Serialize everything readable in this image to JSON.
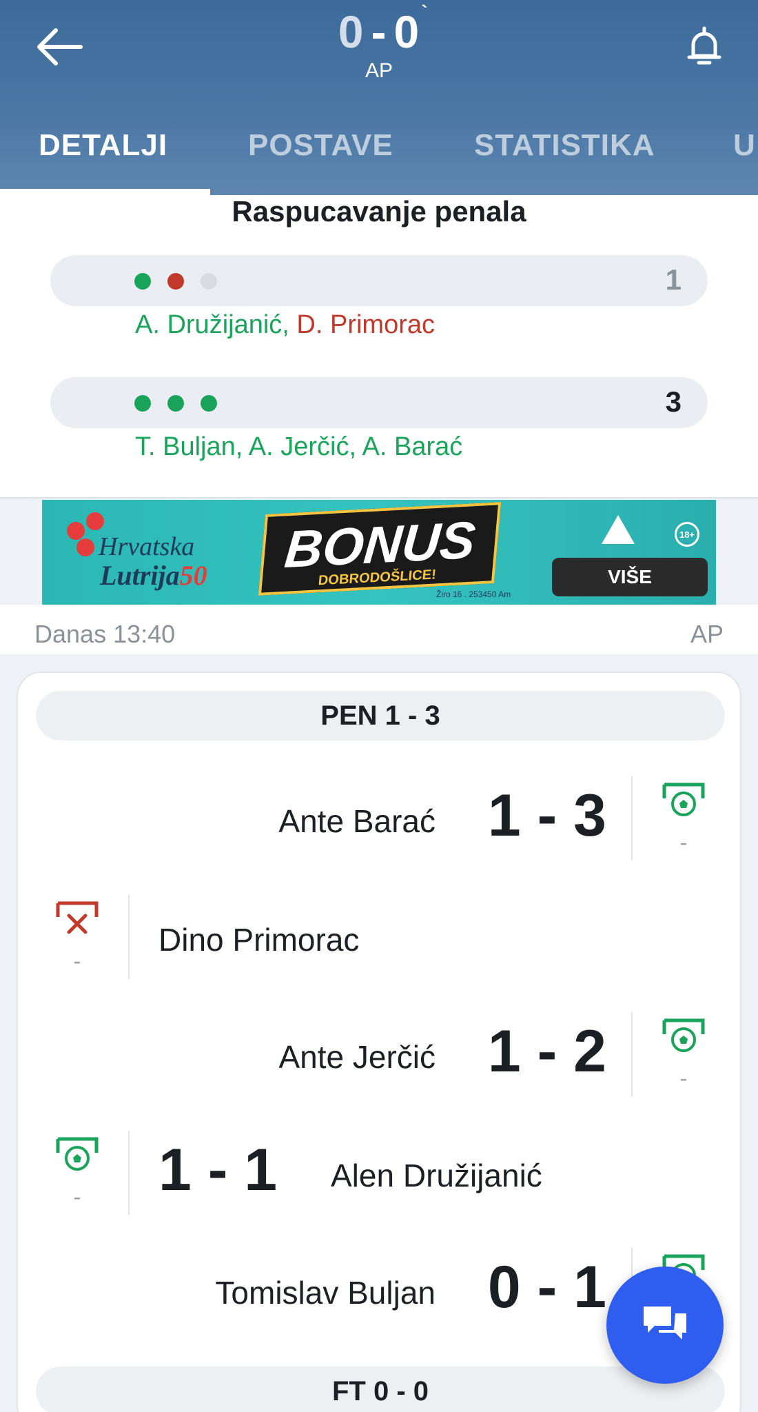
{
  "header": {
    "score_home": "0",
    "score_sep": "-",
    "score_away": "0",
    "score_tick": "`",
    "status": "AP"
  },
  "tabs": [
    {
      "label": "DETALJI",
      "active": true
    },
    {
      "label": "POSTAVE",
      "active": false
    },
    {
      "label": "STATISTIKA",
      "active": false
    },
    {
      "label": "U",
      "active": false
    }
  ],
  "penalty_summary": {
    "title": "Raspucavanje penala",
    "home": {
      "dots": [
        "scored",
        "missed",
        "empty"
      ],
      "count": "1",
      "scorers": [
        {
          "name": "A. Družijanić",
          "result": "scored"
        },
        {
          "name": "D. Primorac",
          "result": "missed"
        }
      ]
    },
    "away": {
      "dots": [
        "scored",
        "scored",
        "scored"
      ],
      "count": "3",
      "scorers": [
        {
          "name": "T. Buljan",
          "result": "scored"
        },
        {
          "name": "A. Jerčić",
          "result": "scored"
        },
        {
          "name": "A. Barać",
          "result": "scored"
        }
      ]
    }
  },
  "ad": {
    "brand_line1": "Hrvatska",
    "brand_line2": "Lutrija",
    "brand_fifty": "50",
    "bonus": "BONUS",
    "bonus_sub": "DOBRODOŠLICE!",
    "legal": "Žiro 16 . 253450 Am",
    "age": "18+",
    "cta": "VIŠE",
    "colors": {
      "background": "#2bb8b5",
      "accent": "#e63c3c"
    }
  },
  "meta": {
    "time": "Danas 13:40",
    "status": "AP"
  },
  "events_card": {
    "pen_section": "PEN 1 - 3",
    "ft_section": "FT 0 - 0",
    "events": [
      {
        "side": "away",
        "player": "Ante Barać",
        "score": "1 - 3",
        "type": "penalty-scored-icon",
        "minute": "-"
      },
      {
        "side": "home",
        "player": "Dino Primorac",
        "score": "",
        "type": "penalty-missed-icon",
        "minute": "-"
      },
      {
        "side": "away",
        "player": "Ante Jerčić",
        "score": "1 - 2",
        "type": "penalty-scored-icon",
        "minute": "-"
      },
      {
        "side": "home",
        "player": "Alen Družijanić",
        "score": "1 - 1",
        "type": "penalty-scored-icon",
        "minute": "-"
      },
      {
        "side": "away",
        "player": "Tomislav Buljan",
        "score": "0 - 1",
        "type": "penalty-scored-icon",
        "minute": "-"
      }
    ]
  },
  "colors": {
    "header": "#4a76a4",
    "scored": "#1aa35a",
    "missed": "#c0392b",
    "fab": "#2f5df0"
  }
}
